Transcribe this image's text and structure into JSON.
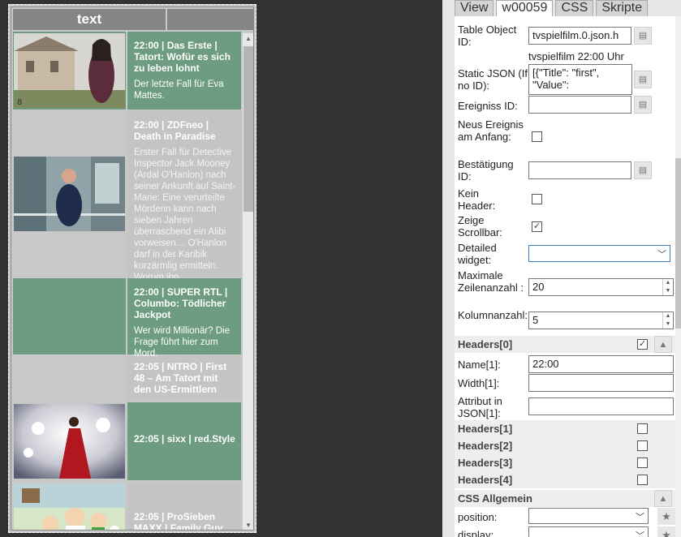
{
  "widget": {
    "header_col1": "text",
    "rows": [
      {
        "time_channel": "22:00 | Das Erste |",
        "title": "Tatort: Wofür es sich zu leben lohnt",
        "desc": "Der letzte Fall für Eva Mattes.",
        "style": "green",
        "image": "house-woman-photo"
      },
      {
        "time_channel": "22:00 | ZDFneo |",
        "title": "Death in Paradise",
        "desc": "Erster Fall für Detective Inspector Jack Mooney (Ardal O'Hanlon) nach seiner Ankunft auf Saint-Marie: Eine verurteilte Mörderin kann nach sieben Jahren überraschend ein Alibi vorweisen… O'Hanlon darf in der Karibik kurzärmlig ermitteln. Worum ihn…",
        "style": "gray",
        "image": "man-balcony-photo"
      },
      {
        "time_channel": "22:00 | SUPER RTL |",
        "title": "Columbo: Tödlicher Jackpot",
        "desc": "Wer wird Millionär? Die Frage führt hier zum Mord.",
        "style": "green",
        "image": ""
      },
      {
        "time_channel": "22:05 | NITRO | First 48 – Am Tatort mit den US-Ermittlern",
        "title": "",
        "desc": "",
        "style": "gray",
        "image": ""
      },
      {
        "time_channel": "22:05 | sixx | red.Style",
        "title": "",
        "desc": "",
        "style": "green",
        "image": "red-dress-photo"
      },
      {
        "time_channel": "22:05 | ProSieben MAXX | Family Guy",
        "title": "",
        "desc": "",
        "style": "gray",
        "image": "cartoon-family-photo"
      }
    ]
  },
  "tabs": [
    "View",
    "w00059",
    "CSS",
    "Skripte"
  ],
  "panel": {
    "table_object_id_label": "Table Object ID:",
    "table_object_id_value": "tvspielfilm.0.json.h",
    "table_object_hint": "tvspielfilm 22:00 Uhr",
    "static_json_label": "Static JSON (If no ID):",
    "static_json_line1": "[{\"Title\": \"first\",",
    "static_json_line2": " \"Value\":",
    "ereigniss_label": "Ereigniss ID:",
    "neus_label": "Neus Ereignis am Anfang:",
    "bestaetigung_label": "Bestätigung ID:",
    "kein_header_label": "Kein Header:",
    "zeige_scrollbar_label": "Zeige Scrollbar:",
    "detailed_widget_label": "Detailed widget:",
    "max_rows_label": "Maximale Zeilenanzahl :",
    "max_rows_value": "20",
    "columns_label": "Kolumnanzahl:",
    "columns_value": "5",
    "headers0_label": "Headers[0]",
    "name_label": "Name[1]:",
    "name_value": "22:00",
    "width_label": "Width[1]:",
    "attribut_label": "Attribut in JSON[1]:",
    "headers1_label": "Headers[1]",
    "headers2_label": "Headers[2]",
    "headers3_label": "Headers[3]",
    "headers4_label": "Headers[4]",
    "css_label": "CSS Allgemein",
    "position_label": "position:",
    "display_label": "display:"
  }
}
